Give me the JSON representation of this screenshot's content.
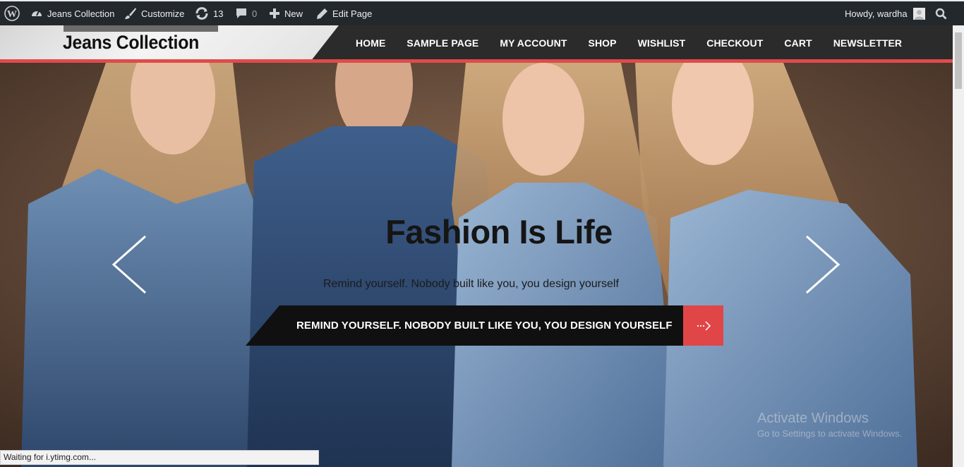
{
  "admin_bar": {
    "site_name": "Jeans Collection",
    "customize": "Customize",
    "updates_count": "13",
    "comments_count": "0",
    "new_label": "New",
    "edit_page": "Edit Page",
    "greeting": "Howdy, wardha",
    "icons": [
      "wordpress-icon",
      "dashboard-icon",
      "brush-icon",
      "updates-icon",
      "comment-icon",
      "plus-icon",
      "pencil-icon",
      "avatar",
      "search-icon"
    ]
  },
  "site": {
    "title": "Jeans Collection",
    "nav": [
      "HOME",
      "SAMPLE PAGE",
      "MY ACCOUNT",
      "SHOP",
      "WISHLIST",
      "CHECKOUT",
      "CART",
      "NEWSLETTER"
    ],
    "accent_color": "#e04b4b"
  },
  "hero": {
    "title": "Fashion Is Life",
    "subtitle": "Remind yourself. Nobody built like you, you design yourself",
    "cta_label": "REMIND YOURSELF. NOBODY BUILT LIKE YOU, YOU DESIGN YOURSELF",
    "prev_icon": "chevron-left-icon",
    "next_icon": "chevron-right-icon"
  },
  "watermark": {
    "title": "Activate Windows",
    "subtitle": "Go to Settings to activate Windows."
  },
  "status_bar": {
    "text": "Waiting for i.ytimg.com..."
  }
}
